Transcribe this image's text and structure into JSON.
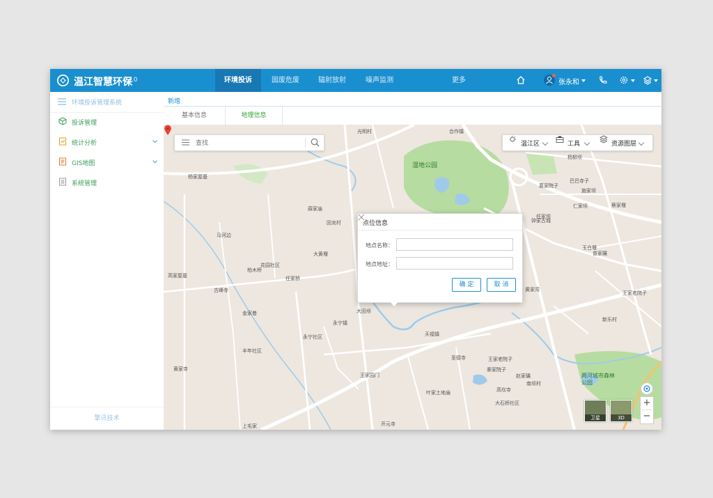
{
  "app": {
    "name": "温江智慧环保",
    "version": "V3.0"
  },
  "nav": {
    "tabs": [
      {
        "label": "环境投诉"
      },
      {
        "label": "固废危废"
      },
      {
        "label": "辐射放射"
      },
      {
        "label": "噪声监测"
      },
      {
        "label": "更多"
      }
    ],
    "active_index": 0
  },
  "user": {
    "name": "张永和"
  },
  "sidebar": {
    "title": "环境投诉管理系统",
    "items": [
      {
        "label": "投诉管理",
        "icon": "cube-icon"
      },
      {
        "label": "统计分析",
        "icon": "chart-doc-icon"
      },
      {
        "label": "GIS地图",
        "icon": "map-doc-icon"
      },
      {
        "label": "系统管理",
        "icon": "doc-icon"
      }
    ],
    "footer": "擎讯技术"
  },
  "breadcrumb": "新增",
  "subtabs": {
    "items": [
      {
        "label": "基本信息"
      },
      {
        "label": "地理信息"
      }
    ],
    "active_index": 1
  },
  "map": {
    "search_placeholder": "查找",
    "tools": {
      "district": "温江区",
      "tool": "工具",
      "layers": "资源图层"
    },
    "labels": [
      "光明村",
      "合作镇",
      "杨家屋基",
      "薛家庙",
      "回龙村",
      "马河边",
      "花园社区",
      "柏木桥",
      "任家桥",
      "古峰寺",
      "金家巷",
      "大田坝",
      "永宁镇",
      "大黄堰",
      "王家老院子",
      "圣德寺",
      "南坝村",
      "天福镇",
      "开元寺",
      "丰年社区",
      "仁家坝",
      "蔡家堰",
      "玉白堰",
      "新乐村",
      "曾家碾",
      "施家坝",
      "永宁社区",
      "王家园门",
      "叶家土地庙",
      "赵家碾",
      "秦家院子",
      "高坎寺",
      "大石桥社区",
      "上毛家",
      "任家坝",
      "王家老院子",
      "杨柳坝",
      "黄家寺",
      "高家屋基",
      "钟家古城",
      "黄家湾",
      "巴巴寺子",
      "葛家院子"
    ],
    "park_label": "湿地公园",
    "park_label2": "两河城市森林公园",
    "maptypes": [
      {
        "label": "卫星"
      },
      {
        "label": "3D"
      }
    ],
    "zoom_in": "+",
    "zoom_out": "−"
  },
  "dialog": {
    "title": "点位信息",
    "name_label": "地点名称：",
    "addr_label": "地点地址：",
    "name_value": "",
    "addr_value": "",
    "ok": "确 定",
    "cancel": "取 消"
  }
}
